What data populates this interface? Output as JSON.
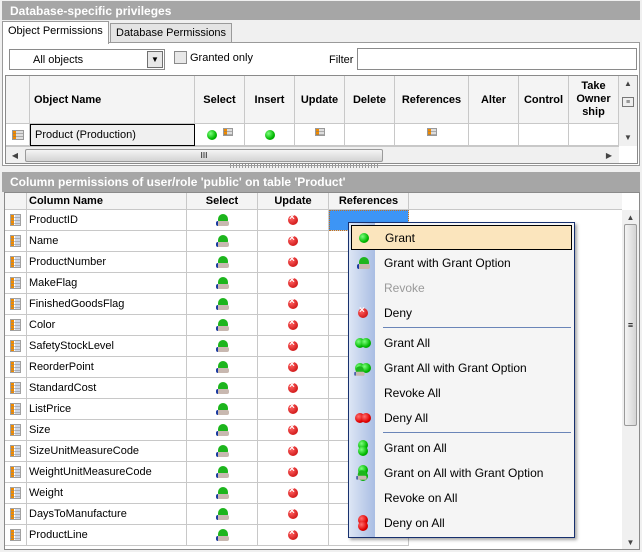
{
  "top_panel": {
    "title": "Database-specific privileges",
    "tabs": [
      {
        "label": "Object Permissions",
        "active": true
      },
      {
        "label": "Database Permissions",
        "active": false
      }
    ],
    "object_filter_select": "All objects",
    "granted_only_label": "Granted only",
    "granted_only_checked": false,
    "filter_label": "Filter",
    "filter_value": "",
    "object_grid": {
      "columns": [
        "Object Name",
        "Select",
        "Insert",
        "Update",
        "Delete",
        "References",
        "Alter",
        "Control",
        "Take Owner ship"
      ],
      "rows": [
        {
          "name": "Product (Production)",
          "icon": "table-icon",
          "select": "grant+column-permissions-icon",
          "insert": "grant",
          "update": "column-permissions-icon",
          "delete": "",
          "references": "column-permissions-icon",
          "alter": "",
          "control": "",
          "take_ownership": ""
        }
      ],
      "hscroll_grip": "III"
    }
  },
  "bottom_panel": {
    "title": "Column permissions of user/role 'public' on table 'Product'",
    "columns": [
      "Column Name",
      "Select",
      "Update",
      "References"
    ],
    "rows": [
      {
        "name": "ProductID",
        "select": "grant-with-grant-option",
        "update": "deny",
        "references": "selected"
      },
      {
        "name": "Name",
        "select": "grant-with-grant-option",
        "update": "deny",
        "references": ""
      },
      {
        "name": "ProductNumber",
        "select": "grant-with-grant-option",
        "update": "deny",
        "references": ""
      },
      {
        "name": "MakeFlag",
        "select": "grant-with-grant-option",
        "update": "deny",
        "references": ""
      },
      {
        "name": "FinishedGoodsFlag",
        "select": "grant-with-grant-option",
        "update": "deny",
        "references": ""
      },
      {
        "name": "Color",
        "select": "grant-with-grant-option",
        "update": "deny",
        "references": ""
      },
      {
        "name": "SafetyStockLevel",
        "select": "grant-with-grant-option",
        "update": "deny",
        "references": ""
      },
      {
        "name": "ReorderPoint",
        "select": "grant-with-grant-option",
        "update": "deny",
        "references": ""
      },
      {
        "name": "StandardCost",
        "select": "grant-with-grant-option",
        "update": "deny",
        "references": ""
      },
      {
        "name": "ListPrice",
        "select": "grant-with-grant-option",
        "update": "deny",
        "references": ""
      },
      {
        "name": "Size",
        "select": "grant-with-grant-option",
        "update": "deny",
        "references": ""
      },
      {
        "name": "SizeUnitMeasureCode",
        "select": "grant-with-grant-option",
        "update": "deny",
        "references": ""
      },
      {
        "name": "WeightUnitMeasureCode",
        "select": "grant-with-grant-option",
        "update": "deny",
        "references": ""
      },
      {
        "name": "Weight",
        "select": "grant-with-grant-option",
        "update": "deny",
        "references": ""
      },
      {
        "name": "DaysToManufacture",
        "select": "grant-with-grant-option",
        "update": "deny",
        "references": ""
      },
      {
        "name": "ProductLine",
        "select": "grant-with-grant-option",
        "update": "deny",
        "references": ""
      }
    ]
  },
  "context_menu": {
    "items": [
      {
        "label": "Grant",
        "icon": "grant-icon",
        "highlighted": true,
        "enabled": true
      },
      {
        "label": "Grant with Grant Option",
        "icon": "grant-with-grant-option-icon",
        "enabled": true
      },
      {
        "label": "Revoke",
        "icon": "",
        "enabled": false
      },
      {
        "label": "Deny",
        "icon": "deny-icon",
        "enabled": true
      },
      {
        "separator": true
      },
      {
        "label": "Grant All",
        "icon": "grant-all-icon",
        "enabled": true
      },
      {
        "label": "Grant All with Grant Option",
        "icon": "grant-all-with-grant-option-icon",
        "enabled": true
      },
      {
        "label": "Revoke All",
        "icon": "",
        "enabled": true
      },
      {
        "label": "Deny All",
        "icon": "deny-all-icon",
        "enabled": true
      },
      {
        "separator": true
      },
      {
        "label": "Grant on All",
        "icon": "grant-on-all-icon",
        "enabled": true
      },
      {
        "label": "Grant on All with Grant Option",
        "icon": "grant-on-all-with-grant-option-icon",
        "enabled": true
      },
      {
        "label": "Revoke on All",
        "icon": "",
        "enabled": true
      },
      {
        "label": "Deny on All",
        "icon": "deny-on-all-icon",
        "enabled": true
      }
    ]
  }
}
